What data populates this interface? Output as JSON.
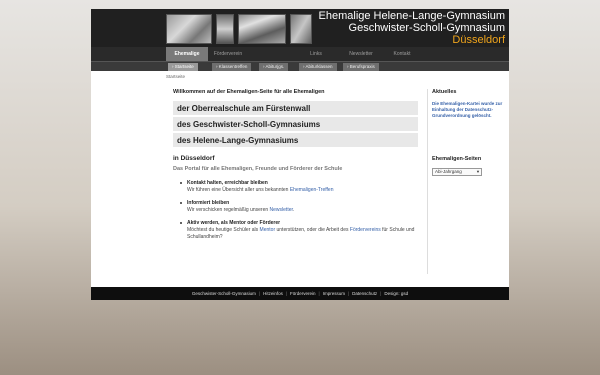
{
  "header": {
    "line1": "Ehemalige Helene-Lange-Gymnasium",
    "line2": "Geschwister-Scholl-Gymnasium",
    "line3": "Düsseldorf"
  },
  "main_nav": [
    "Ehemalige",
    "Förderverein",
    "Links",
    "Newsletter",
    "Kontakt"
  ],
  "sub_nav": [
    "Startseite",
    "Klassentreffen",
    "Abiturjgs.",
    "Abiturklassen",
    "Berufspraxis"
  ],
  "breadcrumb": "Startseite",
  "main": {
    "welcome": "Willkommen auf der Ehemaligen-Seite für alle Ehemaligen",
    "schools": [
      "der Oberrealschule am Fürstenwall",
      "des Geschwister-Scholl-Gymnasiums",
      "des Helene-Lange-Gymnasiums"
    ],
    "city": "in Düsseldorf",
    "portal": "Das Portal für alle Ehemaligen, Freunde und Förderer der Schule",
    "features": [
      {
        "title": "Kontakt halten, erreichbar bleiben",
        "text_before": "Wir führen eine Übersicht aller uns bekannten ",
        "link": "Ehemaligen-Treffen",
        "text_after": ""
      },
      {
        "title": "Informiert bleiben",
        "text_before": "Wir verschicken regelmäßig unseren ",
        "link": "Newsletter",
        "text_after": "."
      },
      {
        "title": "Aktiv werden, als Mentor oder Förderer",
        "text_before": "Möchtest du heutige Schüler als ",
        "link": "Mentor",
        "text_middle": " unterstützen, oder die Arbeit des ",
        "link2": "Fördervereins",
        "text_after": " für Schule und Schullandheim?"
      }
    ]
  },
  "sidebar": {
    "aktuelles_heading": "Aktuelles",
    "aktuelles_text": "Die Ehemaligen-Kartei wurde zur Einhaltung der Datenschutz-Grundverordnung gelöscht.",
    "seiten_heading": "Ehemaligen-Seiten",
    "select_value": "Abi-Jahrgang"
  },
  "footer": [
    "Geschwister-Scholl-Gymnasium",
    "Hitzeinfos",
    "Förderverein",
    "Impressum",
    "Datenschutz",
    "Design: gsd"
  ],
  "colors": {
    "accent": "#f0a51c",
    "link": "#3560a8",
    "header_bg": "#202020"
  }
}
